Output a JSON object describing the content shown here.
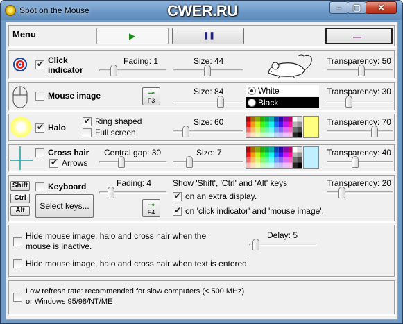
{
  "window": {
    "title": "Spot on the Mouse",
    "watermark": "CWER.RU",
    "min": "–",
    "max": "▢",
    "close": "✕"
  },
  "menu": {
    "label": "Menu",
    "play": "▶",
    "pause": "❚❚",
    "minimize": "—"
  },
  "click_indicator": {
    "checked": true,
    "label_line1": "Click",
    "label_line2": "indicator",
    "fading_label": "Fading: 1",
    "fading": 1,
    "size_label": "Size: 44",
    "size": 44,
    "transparency_label": "Transparency: 50",
    "transparency": 50
  },
  "mouse_image": {
    "checked": false,
    "label": "Mouse image",
    "key": "F3",
    "size_label": "Size: 84",
    "size": 84,
    "color_white": "White",
    "color_black": "Black",
    "selected_color": "White",
    "transparency_label": "Transparency: 30",
    "transparency": 30
  },
  "halo": {
    "checked": true,
    "label": "Halo",
    "ring_label": "Ring shaped",
    "ring_checked": true,
    "fullscreen_label": "Full screen",
    "fullscreen_checked": false,
    "size_label": "Size: 60",
    "size": 60,
    "transparency_label": "Transparency: 70",
    "transparency": 70,
    "color": "#ffff80"
  },
  "cross_hair": {
    "checked": false,
    "label": "Cross hair",
    "arrows_label": "Arrows",
    "arrows_checked": true,
    "gap_label": "Central gap: 30",
    "gap": 30,
    "size_label": "Size: 7",
    "size": 7,
    "transparency_label": "Transparency: 40",
    "transparency": 40,
    "color": "#c0f0ff"
  },
  "keyboard": {
    "checked": false,
    "label": "Keyboard",
    "keys": [
      "Shift",
      "Ctrl",
      "Alt"
    ],
    "select_label": "Select keys...",
    "fading_label": "Fading: 4",
    "fading": 4,
    "key": "F4",
    "show_label": "Show 'Shift', 'Ctrl' and 'Alt' keys",
    "extra_display_label": "on an extra display.",
    "extra_display_checked": true,
    "on_click_label": "on 'click indicator' and 'mouse image'.",
    "on_click_checked": true,
    "transparency_label": "Transparency: 20",
    "transparency": 20
  },
  "hide": {
    "inactive_line1": "Hide mouse image, halo and cross hair when the",
    "inactive_line2": "mouse is inactive.",
    "inactive_checked": false,
    "delay_label": "Delay: 5",
    "delay": 5,
    "text_label": "Hide mouse image, halo and cross hair when text is entered.",
    "text_checked": false
  },
  "refresh": {
    "line1": "Low refresh rate: recommended for slow computers (< 500 MHz)",
    "line2": "or Windows 95/98/NT/ME",
    "checked": false
  }
}
